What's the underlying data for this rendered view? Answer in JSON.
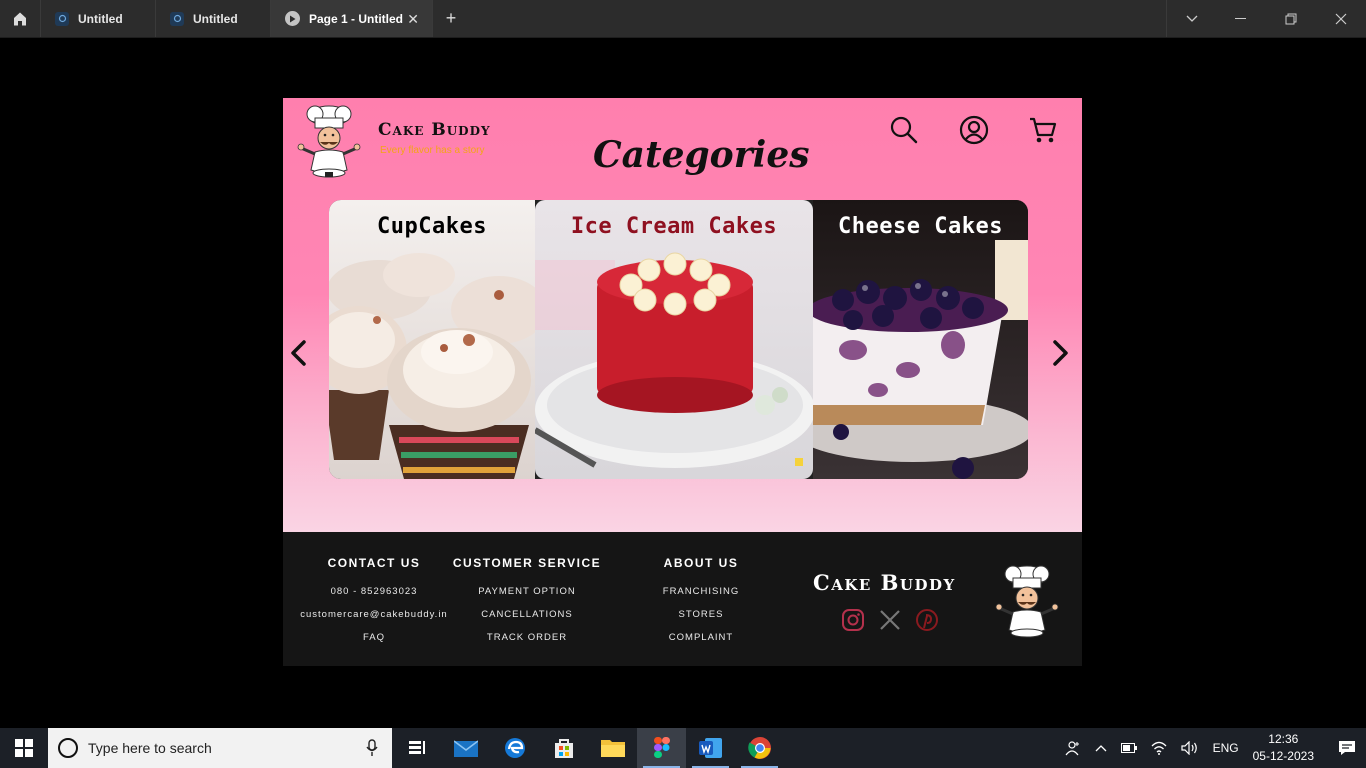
{
  "tabs": [
    {
      "label": "Untitled"
    },
    {
      "label": "Untitled"
    },
    {
      "label": "Page 1 - Untitled",
      "close": "✕"
    }
  ],
  "tab_new": "+",
  "window_controls": {
    "dropdown": "⌵",
    "minimize": "—",
    "restore": "❐",
    "close": "✕"
  },
  "site": {
    "brand": "Cake Buddy",
    "tagline": "Every flavor has a story",
    "page_title": "Categories",
    "header_icons": [
      "search-icon",
      "user-icon",
      "cart-icon"
    ],
    "categories": [
      {
        "title": "CupCakes",
        "title_color": "#111111"
      },
      {
        "title": "Ice Cream Cakes",
        "title_color": "#8f1020"
      },
      {
        "title": "Cheese Cakes",
        "title_color": "#ffffff"
      }
    ]
  },
  "footer": {
    "contact": {
      "heading": "CONTACT US",
      "items": [
        "080 - 852963023",
        "customercare@cakebuddy.in",
        "FAQ"
      ]
    },
    "service": {
      "heading": "CUSTOMER SERVICE",
      "items": [
        "PAYMENT OPTION",
        "CANCELLATIONS",
        "TRACK ORDER"
      ]
    },
    "about": {
      "heading": "ABOUT US",
      "items": [
        "FRANCHISING",
        "STORES",
        "COMPLAINT"
      ]
    },
    "brand": "Cake Buddy",
    "social": [
      "instagram-icon",
      "x-icon",
      "pinterest-icon"
    ]
  },
  "taskbar": {
    "search_placeholder": "Type here to search",
    "apps": [
      "task-view-icon",
      "mail-icon",
      "edge-icon",
      "store-icon",
      "file-explorer-icon",
      "figma-icon",
      "word-icon",
      "chrome-icon"
    ],
    "language": "ENG",
    "time": "12:36",
    "date": "05-12-2023"
  },
  "colors": {
    "hero_pink": "#ff7fae",
    "footer_bg": "#151515",
    "tagline": "#f4a516"
  }
}
